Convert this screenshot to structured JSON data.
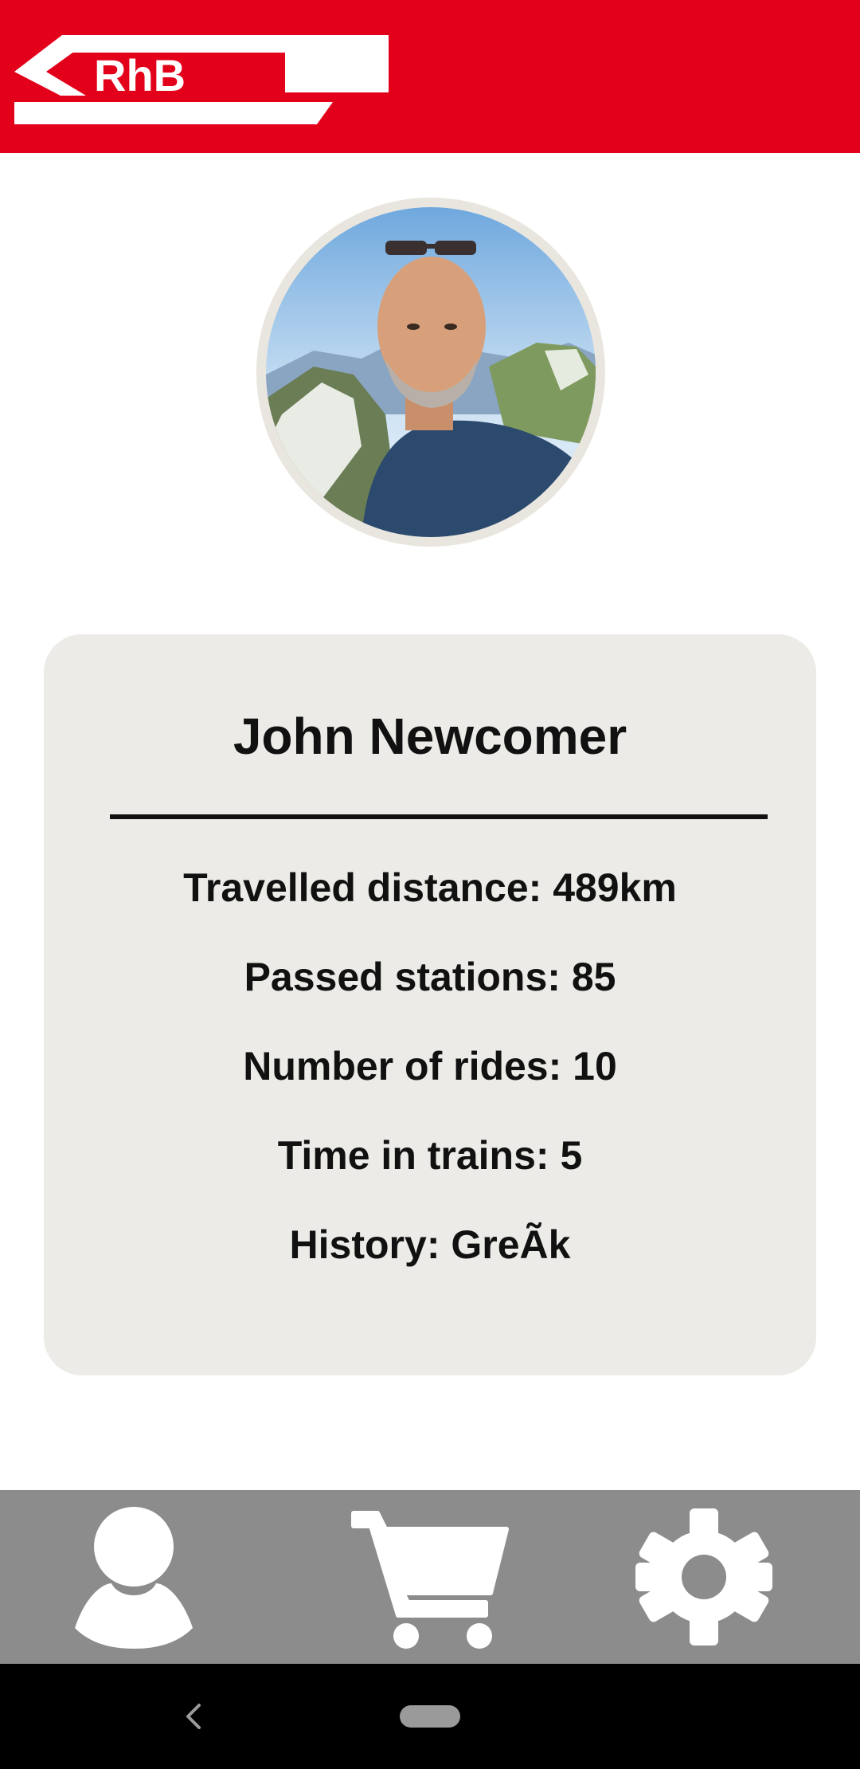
{
  "header": {
    "logo_text": "RhB",
    "background_color": "#e3001b"
  },
  "profile": {
    "avatar_icon": "user-photo",
    "name": "John Newcomer"
  },
  "stats": [
    {
      "text": "Travelled distance: 489km"
    },
    {
      "text": "Passed stations: 85"
    },
    {
      "text": "Number of rides: 10"
    },
    {
      "text": "Time in trains: 5"
    },
    {
      "text": "History: GreÃk"
    }
  ],
  "bottom_nav": {
    "items": [
      {
        "icon": "person-icon",
        "label": "Profile"
      },
      {
        "icon": "cart-icon",
        "label": "Shop"
      },
      {
        "icon": "gear-icon",
        "label": "Settings"
      }
    ],
    "background_color": "#8c8c8c"
  },
  "system_nav": {
    "back_icon": "chevron-left-icon",
    "home_icon": "home-pill-icon"
  },
  "colors": {
    "card_background": "#ecebe7",
    "text": "#111111"
  }
}
